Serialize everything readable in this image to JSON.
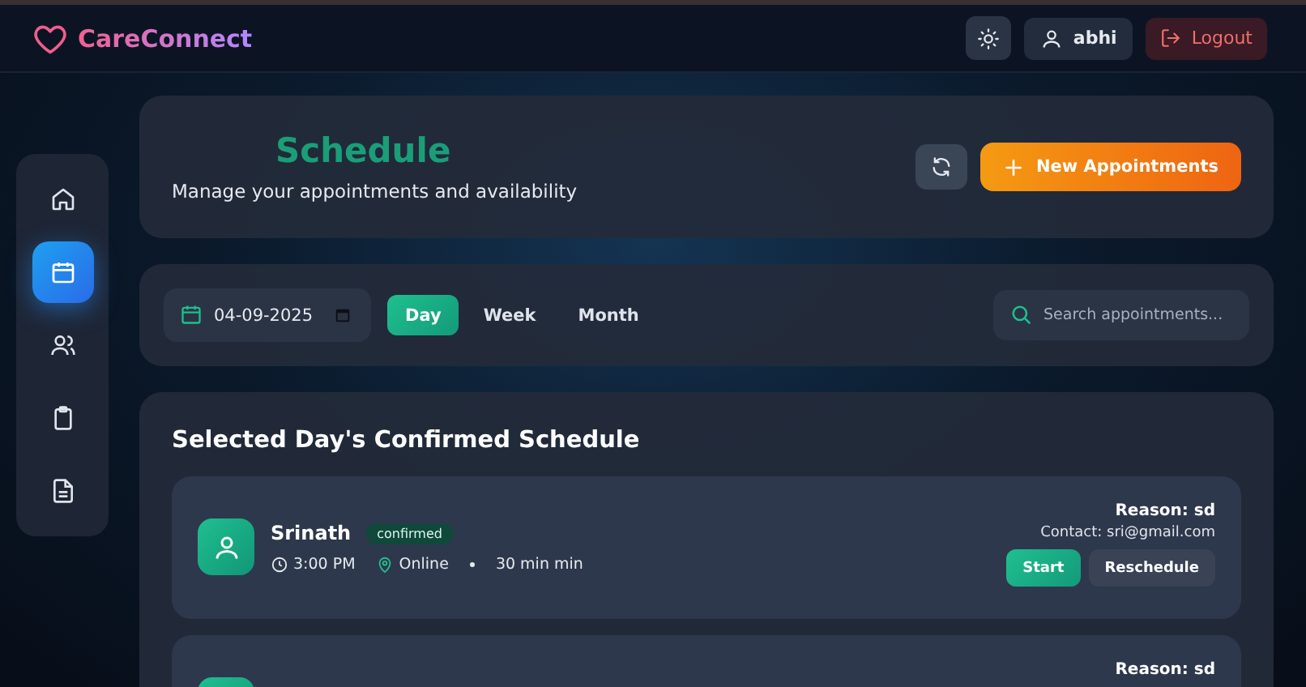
{
  "brand": "CareConnect",
  "topbar": {
    "user": "abhi",
    "logout": "Logout"
  },
  "sidebar": {
    "items": [
      {
        "kind": "home",
        "selected": false
      },
      {
        "kind": "calendar",
        "selected": true
      },
      {
        "kind": "users",
        "selected": false
      },
      {
        "kind": "clipboard",
        "selected": false
      },
      {
        "kind": "document",
        "selected": false
      }
    ]
  },
  "header": {
    "title": "Schedule",
    "subtitle": "Manage your appointments and availability",
    "new_button": "New Appointments"
  },
  "filters": {
    "date": "04-09-2025",
    "tabs": [
      {
        "label": "Day",
        "selected": true
      },
      {
        "label": "Week",
        "selected": false
      },
      {
        "label": "Month",
        "selected": false
      }
    ],
    "search": {
      "placeholder": "Search appointments..."
    }
  },
  "schedule": {
    "title": "Selected Day's Confirmed Schedule",
    "appointments": [
      {
        "name": "Srinath",
        "status": "confirmed",
        "time": "3:00 PM",
        "location": "Online",
        "duration": "30 min min",
        "reason": "Reason: sd",
        "contact": "Contact: sri@gmail.com",
        "actions": [
          "Start",
          "Reschedule"
        ]
      },
      {
        "reason": "Reason: sd"
      }
    ]
  }
}
